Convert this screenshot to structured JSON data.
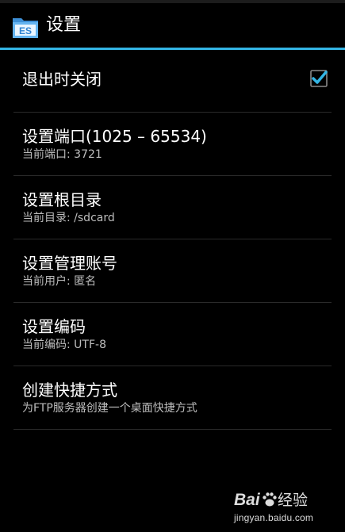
{
  "header": {
    "title": "设置",
    "icon": "es-file-explorer-icon"
  },
  "preferences": [
    {
      "title": "退出时关闭",
      "checkbox": true
    },
    {
      "title": "设置端口(1025 – 65534)",
      "summary": "当前端口: 3721"
    },
    {
      "title": "设置根目录",
      "summary": "当前目录: /sdcard"
    },
    {
      "title": "设置管理账号",
      "summary": "当前用户: 匿名"
    },
    {
      "title": "设置编码",
      "summary": "当前编码: UTF-8"
    },
    {
      "title": "创建快捷方式",
      "summary": "为FTP服务器创建一个桌面快捷方式"
    }
  ],
  "watermark": {
    "brand": "Baidu经验",
    "url": "jingyan.baidu.com"
  },
  "colors": {
    "background": "#000000",
    "accent": "#33b5e5",
    "title_text": "#ffffff",
    "summary_text": "#bdbdbd",
    "divider": "#2a2a2a"
  }
}
